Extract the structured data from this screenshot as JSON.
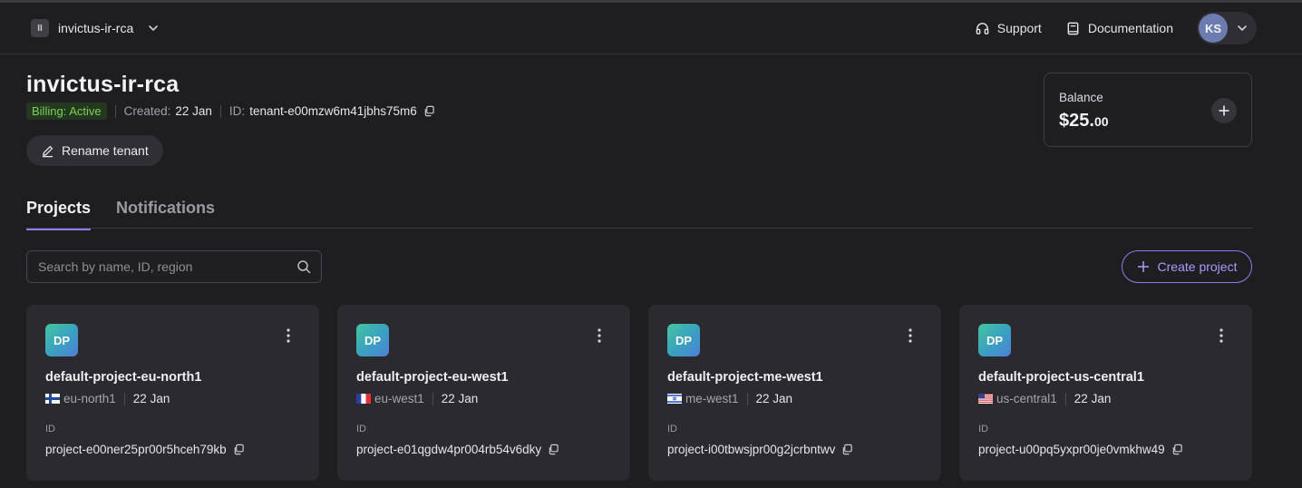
{
  "header": {
    "tenant_badge": "II",
    "tenant_name": "invictus-ir-rca",
    "support_label": "Support",
    "documentation_label": "Documentation",
    "user_initials": "KS"
  },
  "tenant": {
    "title": "invictus-ir-rca",
    "billing_status": "Billing: Active",
    "created_label": "Created:",
    "created_value": "22 Jan",
    "id_label": "ID:",
    "id_value": "tenant-e00mzw6m41jbhs75m6",
    "rename_label": "Rename tenant"
  },
  "balance": {
    "label": "Balance",
    "amount_main": "$25.",
    "amount_cents": "00"
  },
  "tabs": [
    {
      "label": "Projects",
      "active": true
    },
    {
      "label": "Notifications",
      "active": false
    }
  ],
  "search": {
    "placeholder": "Search by name, ID, region",
    "value": ""
  },
  "create_project_label": "Create project",
  "projects": [
    {
      "avatar": "DP",
      "name": "default-project-eu-north1",
      "flag": "fi",
      "region": "eu-north1",
      "date": "22 Jan",
      "id_label": "ID",
      "id": "project-e00ner25pr00r5hceh79kb"
    },
    {
      "avatar": "DP",
      "name": "default-project-eu-west1",
      "flag": "fr",
      "region": "eu-west1",
      "date": "22 Jan",
      "id_label": "ID",
      "id": "project-e01qgdw4pr004rb54v6dky"
    },
    {
      "avatar": "DP",
      "name": "default-project-me-west1",
      "flag": "il",
      "region": "me-west1",
      "date": "22 Jan",
      "id_label": "ID",
      "id": "project-i00tbwsjpr00g2jcrbntwv"
    },
    {
      "avatar": "DP",
      "name": "default-project-us-central1",
      "flag": "us",
      "region": "us-central1",
      "date": "22 Jan",
      "id_label": "ID",
      "id": "project-u00pq5yxpr00je0vmkhw49"
    }
  ],
  "colors": {
    "background": "#1e1e21",
    "card": "#2a2a2f",
    "accent": "#8b7cf0",
    "billing_active": "#7ccf5b"
  }
}
